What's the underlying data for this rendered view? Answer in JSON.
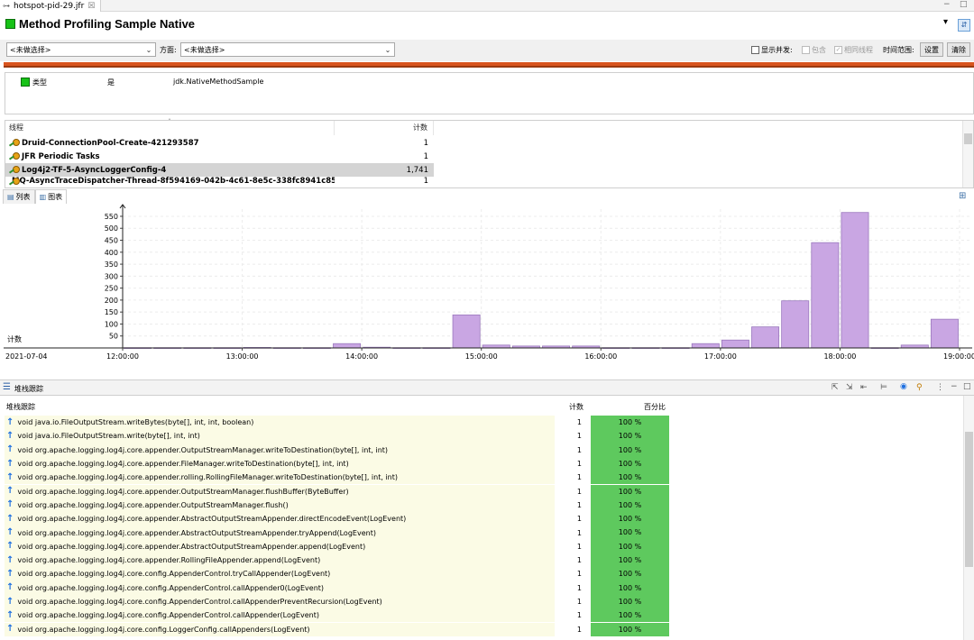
{
  "editor_tab": {
    "label": "hotspot-pid-29.jfr",
    "close": "☒"
  },
  "window_controls": {
    "minimize": "−",
    "maximize": "□"
  },
  "page": {
    "title": "Method Profiling Sample Native",
    "menu": "▾"
  },
  "filter": {
    "left_select": "<未做选择>",
    "direction_label": "方面:",
    "direction_select": "<未做选择>",
    "show_concurrent": "显示并发:",
    "include": "包含",
    "same_thread": "相同线程",
    "time_range": "时间范围:",
    "settings_button": "设置",
    "clear_button": "清除"
  },
  "attributes": {
    "key": "类型",
    "op": "是",
    "value": "jdk.NativeMethodSample"
  },
  "thread_table": {
    "headers": [
      "线程",
      "计数"
    ],
    "rows": [
      {
        "name": "Druid-ConnectionPool-Create-421293587",
        "count": "1"
      },
      {
        "name": "JFR Periodic Tasks",
        "count": "1"
      },
      {
        "name": "Log4j2-TF-5-AsyncLoggerConfig-4",
        "count": "1,741"
      },
      {
        "name": "MQ-AsyncTraceDispatcher-Thread-8f594169-042b-4c61-8e5c-338fc8941c85",
        "count": "1"
      }
    ]
  },
  "view_tabs": [
    "列表",
    "图表"
  ],
  "chart_data": {
    "type": "bar",
    "ylabel": "计数",
    "xlabel": "",
    "date_label": "2021-07-04",
    "x_ticks": [
      "12:00:00",
      "13:00:00",
      "14:00:00",
      "15:00:00",
      "16:00:00",
      "17:00:00",
      "18:00:00",
      "19:00:00"
    ],
    "y_ticks": [
      50,
      100,
      150,
      200,
      250,
      300,
      350,
      400,
      450,
      500,
      550
    ],
    "ylim": [
      0,
      580
    ],
    "xlim_hours": [
      12,
      19
    ],
    "bar_width_minutes": 15,
    "bars": [
      {
        "start": "12:00",
        "value": 1
      },
      {
        "start": "12:15",
        "value": 1
      },
      {
        "start": "12:30",
        "value": 1
      },
      {
        "start": "12:45",
        "value": 1
      },
      {
        "start": "13:00",
        "value": 2
      },
      {
        "start": "13:15",
        "value": 1
      },
      {
        "start": "13:30",
        "value": 1
      },
      {
        "start": "13:45",
        "value": 18
      },
      {
        "start": "14:00",
        "value": 3
      },
      {
        "start": "14:15",
        "value": 1
      },
      {
        "start": "14:30",
        "value": 1
      },
      {
        "start": "14:45",
        "value": 138
      },
      {
        "start": "15:00",
        "value": 12
      },
      {
        "start": "15:15",
        "value": 8
      },
      {
        "start": "15:30",
        "value": 8
      },
      {
        "start": "15:45",
        "value": 8
      },
      {
        "start": "16:00",
        "value": 1
      },
      {
        "start": "16:15",
        "value": 1
      },
      {
        "start": "16:30",
        "value": 1
      },
      {
        "start": "16:45",
        "value": 18
      },
      {
        "start": "17:00",
        "value": 33
      },
      {
        "start": "17:15",
        "value": 88
      },
      {
        "start": "17:30",
        "value": 197
      },
      {
        "start": "17:45",
        "value": 440
      },
      {
        "start": "18:00",
        "value": 566
      },
      {
        "start": "18:15",
        "value": 1
      },
      {
        "start": "18:30",
        "value": 12
      },
      {
        "start": "18:45",
        "value": 120
      }
    ],
    "bar_color": "#c9a6e3",
    "grid": true
  },
  "stack": {
    "title": "堆栈跟踪",
    "headers": [
      "堆栈跟踪",
      "计数",
      "百分比"
    ],
    "rows": [
      {
        "frame": "void java.io.FileOutputStream.writeBytes(byte[], int, int, boolean)",
        "count": "1",
        "pct": "100 %"
      },
      {
        "frame": "void java.io.FileOutputStream.write(byte[], int, int)",
        "count": "1",
        "pct": "100 %"
      },
      {
        "frame": "void org.apache.logging.log4j.core.appender.OutputStreamManager.writeToDestination(byte[], int, int)",
        "count": "1",
        "pct": "100 %"
      },
      {
        "frame": "void org.apache.logging.log4j.core.appender.FileManager.writeToDestination(byte[], int, int)",
        "count": "1",
        "pct": "100 %"
      },
      {
        "frame": "void org.apache.logging.log4j.core.appender.rolling.RollingFileManager.writeToDestination(byte[], int, int)",
        "count": "1",
        "pct": "100 %"
      },
      {
        "frame": "void org.apache.logging.log4j.core.appender.OutputStreamManager.flushBuffer(ByteBuffer)",
        "count": "1",
        "pct": "100 %"
      },
      {
        "frame": "void org.apache.logging.log4j.core.appender.OutputStreamManager.flush()",
        "count": "1",
        "pct": "100 %"
      },
      {
        "frame": "void org.apache.logging.log4j.core.appender.AbstractOutputStreamAppender.directEncodeEvent(LogEvent)",
        "count": "1",
        "pct": "100 %"
      },
      {
        "frame": "void org.apache.logging.log4j.core.appender.AbstractOutputStreamAppender.tryAppend(LogEvent)",
        "count": "1",
        "pct": "100 %"
      },
      {
        "frame": "void org.apache.logging.log4j.core.appender.AbstractOutputStreamAppender.append(LogEvent)",
        "count": "1",
        "pct": "100 %"
      },
      {
        "frame": "void org.apache.logging.log4j.core.appender.RollingFileAppender.append(LogEvent)",
        "count": "1",
        "pct": "100 %"
      },
      {
        "frame": "void org.apache.logging.log4j.core.config.AppenderControl.tryCallAppender(LogEvent)",
        "count": "1",
        "pct": "100 %"
      },
      {
        "frame": "void org.apache.logging.log4j.core.config.AppenderControl.callAppender0(LogEvent)",
        "count": "1",
        "pct": "100 %"
      },
      {
        "frame": "void org.apache.logging.log4j.core.config.AppenderControl.callAppenderPreventRecursion(LogEvent)",
        "count": "1",
        "pct": "100 %"
      },
      {
        "frame": "void org.apache.logging.log4j.core.config.AppenderControl.callAppender(LogEvent)",
        "count": "1",
        "pct": "100 %"
      },
      {
        "frame": "void org.apache.logging.log4j.core.config.LoggerConfig.callAppenders(LogEvent)",
        "count": "1",
        "pct": "100 %"
      }
    ]
  },
  "colors": {
    "accent_green": "#17c217",
    "orange_bar": "#d9541e",
    "pct_green": "#5ec95e",
    "bar": "#c9a6e3"
  }
}
